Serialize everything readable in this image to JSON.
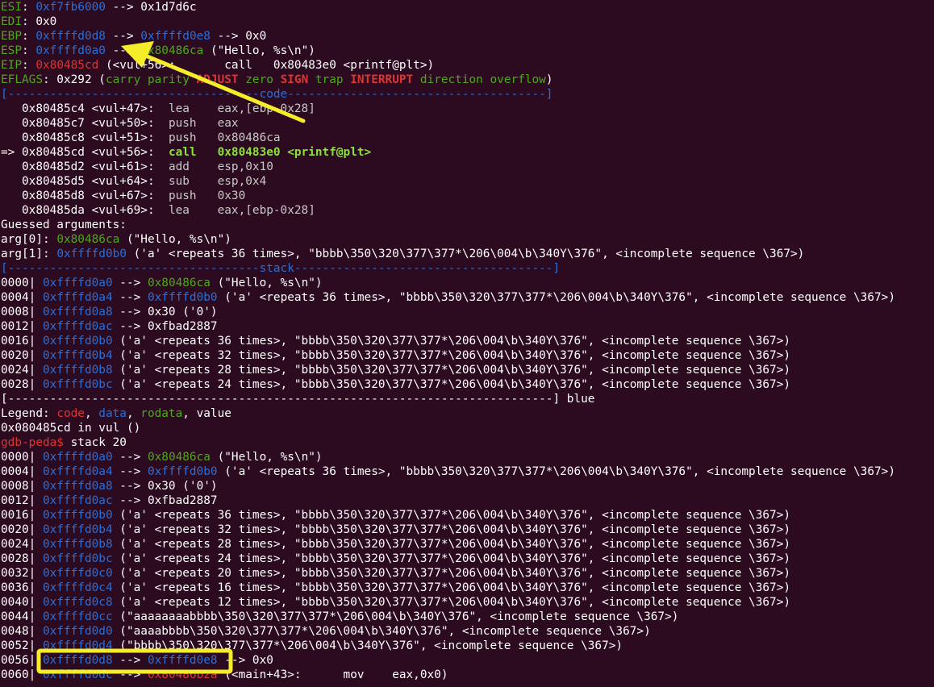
{
  "registers": [
    {
      "name": "ESI",
      "parts": [
        {
          "t": "ESI",
          "c": "green"
        },
        {
          "t": ": "
        },
        {
          "t": "0xf7fb6000",
          "c": "blue"
        },
        {
          "t": " --> 0x1d7d6c"
        }
      ]
    },
    {
      "name": "EDI",
      "parts": [
        {
          "t": "EDI",
          "c": "green"
        },
        {
          "t": ": 0x0"
        }
      ]
    },
    {
      "name": "EBP",
      "parts": [
        {
          "t": "EBP",
          "c": "green"
        },
        {
          "t": ": "
        },
        {
          "t": "0xffffd0d8",
          "c": "blue"
        },
        {
          "t": " --> "
        },
        {
          "t": "0xffffd0e8",
          "c": "blue"
        },
        {
          "t": " --> 0x0"
        }
      ]
    },
    {
      "name": "ESP",
      "parts": [
        {
          "t": "ESP",
          "c": "green"
        },
        {
          "t": ": "
        },
        {
          "t": "0xffffd0a0",
          "c": "blue"
        },
        {
          "t": " --> "
        },
        {
          "t": "0x80486ca",
          "c": "green"
        },
        {
          "t": " (\"Hello, %s\\n\")"
        }
      ]
    },
    {
      "name": "EIP",
      "parts": [
        {
          "t": "EIP",
          "c": "green"
        },
        {
          "t": ": "
        },
        {
          "t": "0x80485cd",
          "c": "red"
        },
        {
          "t": " (<vul+56>:       call   0x80483e0 <printf@plt>)"
        }
      ]
    },
    {
      "name": "EFLAGS",
      "parts": [
        {
          "t": "EFLAGS",
          "c": "green"
        },
        {
          "t": ": 0x292 ("
        },
        {
          "t": "carry parity ",
          "c": "green"
        },
        {
          "t": "ADJUST",
          "c": "redb"
        },
        {
          "t": " zero ",
          "c": "green"
        },
        {
          "t": "SIGN",
          "c": "redb"
        },
        {
          "t": " trap ",
          "c": "green"
        },
        {
          "t": "INTERRUPT",
          "c": "redb"
        },
        {
          "t": " direction overflow",
          "c": "green"
        },
        {
          "t": ")"
        }
      ]
    }
  ],
  "code_header": "[------------------------------------code-------------------------------------]",
  "code_lines": [
    {
      "text": "   0x80485c4 <vul+47>:  ",
      "instr": "lea    eax,[ebp-0x28]",
      "current": false
    },
    {
      "text": "   0x80485c7 <vul+50>:  ",
      "instr": "push   eax",
      "current": false
    },
    {
      "text": "   0x80485c8 <vul+51>:  ",
      "instr": "push   0x80486ca",
      "current": false
    },
    {
      "text": "=> 0x80485cd <vul+56>:  ",
      "instr": "call   0x80483e0 <printf@plt>",
      "current": true
    },
    {
      "text": "   0x80485d2 <vul+61>:  ",
      "instr": "add    esp,0x10",
      "current": false
    },
    {
      "text": "   0x80485d5 <vul+64>:  ",
      "instr": "sub    esp,0x4",
      "current": false
    },
    {
      "text": "   0x80485d8 <vul+67>:  ",
      "instr": "push   0x30",
      "current": false
    },
    {
      "text": "   0x80485da <vul+69>:  ",
      "instr": "lea    eax,[ebp-0x28]",
      "current": false
    }
  ],
  "guessed_title": "Guessed arguments:",
  "args": [
    {
      "parts": [
        {
          "t": "arg[0]: "
        },
        {
          "t": "0x80486ca",
          "c": "green"
        },
        {
          "t": " (\"Hello, %s\\n\")"
        }
      ]
    },
    {
      "parts": [
        {
          "t": "arg[1]: "
        },
        {
          "t": "0xffffd0b0",
          "c": "blue"
        },
        {
          "t": " ('a' <repeats 36 times>, \"bbbb\\350\\320\\377\\377*\\206\\004\\b\\340Y\\376\", <incomplete sequence \\367>)"
        }
      ]
    }
  ],
  "stack_header": "[------------------------------------stack-------------------------------------]",
  "stack_lines": [
    {
      "parts": [
        {
          "t": "0000| "
        },
        {
          "t": "0xffffd0a0",
          "c": "blue"
        },
        {
          "t": " --> "
        },
        {
          "t": "0x80486ca",
          "c": "green"
        },
        {
          "t": " (\"Hello, %s\\n\")"
        }
      ]
    },
    {
      "parts": [
        {
          "t": "0004| "
        },
        {
          "t": "0xffffd0a4",
          "c": "blue"
        },
        {
          "t": " --> "
        },
        {
          "t": "0xffffd0b0",
          "c": "blue"
        },
        {
          "t": " ('a' <repeats 36 times>, \"bbbb\\350\\320\\377\\377*\\206\\004\\b\\340Y\\376\", <incomplete sequence \\367>)"
        }
      ]
    },
    {
      "parts": [
        {
          "t": "0008| "
        },
        {
          "t": "0xffffd0a8",
          "c": "blue"
        },
        {
          "t": " --> 0x30 ('0')"
        }
      ]
    },
    {
      "parts": [
        {
          "t": "0012| "
        },
        {
          "t": "0xffffd0ac",
          "c": "blue"
        },
        {
          "t": " --> 0xfbad2887"
        }
      ]
    },
    {
      "parts": [
        {
          "t": "0016| "
        },
        {
          "t": "0xffffd0b0",
          "c": "blue"
        },
        {
          "t": " ('a' <repeats 36 times>, \"bbbb\\350\\320\\377\\377*\\206\\004\\b\\340Y\\376\", <incomplete sequence \\367>)"
        }
      ]
    },
    {
      "parts": [
        {
          "t": "0020| "
        },
        {
          "t": "0xffffd0b4",
          "c": "blue"
        },
        {
          "t": " ('a' <repeats 32 times>, \"bbbb\\350\\320\\377\\377*\\206\\004\\b\\340Y\\376\", <incomplete sequence \\367>)"
        }
      ]
    },
    {
      "parts": [
        {
          "t": "0024| "
        },
        {
          "t": "0xffffd0b8",
          "c": "blue"
        },
        {
          "t": " ('a' <repeats 28 times>, \"bbbb\\350\\320\\377\\377*\\206\\004\\b\\340Y\\376\", <incomplete sequence \\367>)"
        }
      ]
    },
    {
      "parts": [
        {
          "t": "0028| "
        },
        {
          "t": "0xffffd0bc",
          "c": "blue"
        },
        {
          "t": " ('a' <repeats 24 times>, \"bbbb\\350\\320\\377\\377*\\206\\004\\b\\340Y\\376\", <incomplete sequence \\367>)"
        }
      ]
    }
  ],
  "footer_rule": "[------------------------------------------------------------------------------]",
  "footer_rule_suffix": " blue",
  "legend": [
    {
      "t": "Legend: "
    },
    {
      "t": "code",
      "c": "red"
    },
    {
      "t": ", "
    },
    {
      "t": "data",
      "c": "blue"
    },
    {
      "t": ", "
    },
    {
      "t": "rodata",
      "c": "green"
    },
    {
      "t": ", value"
    }
  ],
  "location": "0x080485cd in vul ()",
  "prompt": "gdb-peda$",
  "command": " stack 20",
  "stack20_lines": [
    {
      "parts": [
        {
          "t": "0000| "
        },
        {
          "t": "0xffffd0a0",
          "c": "blue"
        },
        {
          "t": " --> "
        },
        {
          "t": "0x80486ca",
          "c": "green"
        },
        {
          "t": " (\"Hello, %s\\n\")"
        }
      ]
    },
    {
      "parts": [
        {
          "t": "0004| "
        },
        {
          "t": "0xffffd0a4",
          "c": "blue"
        },
        {
          "t": " --> "
        },
        {
          "t": "0xffffd0b0",
          "c": "blue"
        },
        {
          "t": " ('a' <repeats 36 times>, \"bbbb\\350\\320\\377\\377*\\206\\004\\b\\340Y\\376\", <incomplete sequence \\367>)"
        }
      ]
    },
    {
      "parts": [
        {
          "t": "0008| "
        },
        {
          "t": "0xffffd0a8",
          "c": "blue"
        },
        {
          "t": " --> 0x30 ('0')"
        }
      ]
    },
    {
      "parts": [
        {
          "t": "0012| "
        },
        {
          "t": "0xffffd0ac",
          "c": "blue"
        },
        {
          "t": " --> 0xfbad2887"
        }
      ]
    },
    {
      "parts": [
        {
          "t": "0016| "
        },
        {
          "t": "0xffffd0b0",
          "c": "blue"
        },
        {
          "t": " ('a' <repeats 36 times>, \"bbbb\\350\\320\\377\\377*\\206\\004\\b\\340Y\\376\", <incomplete sequence \\367>)"
        }
      ]
    },
    {
      "parts": [
        {
          "t": "0020| "
        },
        {
          "t": "0xffffd0b4",
          "c": "blue"
        },
        {
          "t": " ('a' <repeats 32 times>, \"bbbb\\350\\320\\377\\377*\\206\\004\\b\\340Y\\376\", <incomplete sequence \\367>)"
        }
      ]
    },
    {
      "parts": [
        {
          "t": "0024| "
        },
        {
          "t": "0xffffd0b8",
          "c": "blue"
        },
        {
          "t": " ('a' <repeats 28 times>, \"bbbb\\350\\320\\377\\377*\\206\\004\\b\\340Y\\376\", <incomplete sequence \\367>)"
        }
      ]
    },
    {
      "parts": [
        {
          "t": "0028| "
        },
        {
          "t": "0xffffd0bc",
          "c": "blue"
        },
        {
          "t": " ('a' <repeats 24 times>, \"bbbb\\350\\320\\377\\377*\\206\\004\\b\\340Y\\376\", <incomplete sequence \\367>)"
        }
      ]
    },
    {
      "parts": [
        {
          "t": "0032| "
        },
        {
          "t": "0xffffd0c0",
          "c": "blue"
        },
        {
          "t": " ('a' <repeats 20 times>, \"bbbb\\350\\320\\377\\377*\\206\\004\\b\\340Y\\376\", <incomplete sequence \\367>)"
        }
      ]
    },
    {
      "parts": [
        {
          "t": "0036| "
        },
        {
          "t": "0xffffd0c4",
          "c": "blue"
        },
        {
          "t": " ('a' <repeats 16 times>, \"bbbb\\350\\320\\377\\377*\\206\\004\\b\\340Y\\376\", <incomplete sequence \\367>)"
        }
      ]
    },
    {
      "parts": [
        {
          "t": "0040| "
        },
        {
          "t": "0xffffd0c8",
          "c": "blue"
        },
        {
          "t": " ('a' <repeats 12 times>, \"bbbb\\350\\320\\377\\377*\\206\\004\\b\\340Y\\376\", <incomplete sequence \\367>)"
        }
      ]
    },
    {
      "parts": [
        {
          "t": "0044| "
        },
        {
          "t": "0xffffd0cc",
          "c": "blue"
        },
        {
          "t": " (\"aaaaaaaabbbb\\350\\320\\377\\377*\\206\\004\\b\\340Y\\376\", <incomplete sequence \\367>)"
        }
      ]
    },
    {
      "parts": [
        {
          "t": "0048| "
        },
        {
          "t": "0xffffd0d0",
          "c": "blue"
        },
        {
          "t": " (\"aaaabbbb\\350\\320\\377\\377*\\206\\004\\b\\340Y\\376\", <incomplete sequence \\367>)"
        }
      ]
    },
    {
      "parts": [
        {
          "t": "0052| "
        },
        {
          "t": "0xffffd0d4",
          "c": "blue"
        },
        {
          "t": " (\"bbbb\\350\\320\\377\\377*\\206\\004\\b\\340Y\\376\", <incomplete sequence \\367>)"
        }
      ]
    },
    {
      "parts": [
        {
          "t": "0056| "
        },
        {
          "t": "0xffffd0d8",
          "c": "blue"
        },
        {
          "t": " --> "
        },
        {
          "t": "0xffffd0e8",
          "c": "blue"
        },
        {
          "t": " --> 0x0"
        }
      ]
    },
    {
      "parts": [
        {
          "t": "0060| "
        },
        {
          "t": "0xffffd0dc",
          "c": "blue"
        },
        {
          "t": " --> "
        },
        {
          "t": "0x80486b2a",
          "c": "red"
        },
        {
          "t": " (<main+43>:      mov    eax,0x0)"
        }
      ]
    }
  ],
  "annotation_color": "#f5ec2a"
}
